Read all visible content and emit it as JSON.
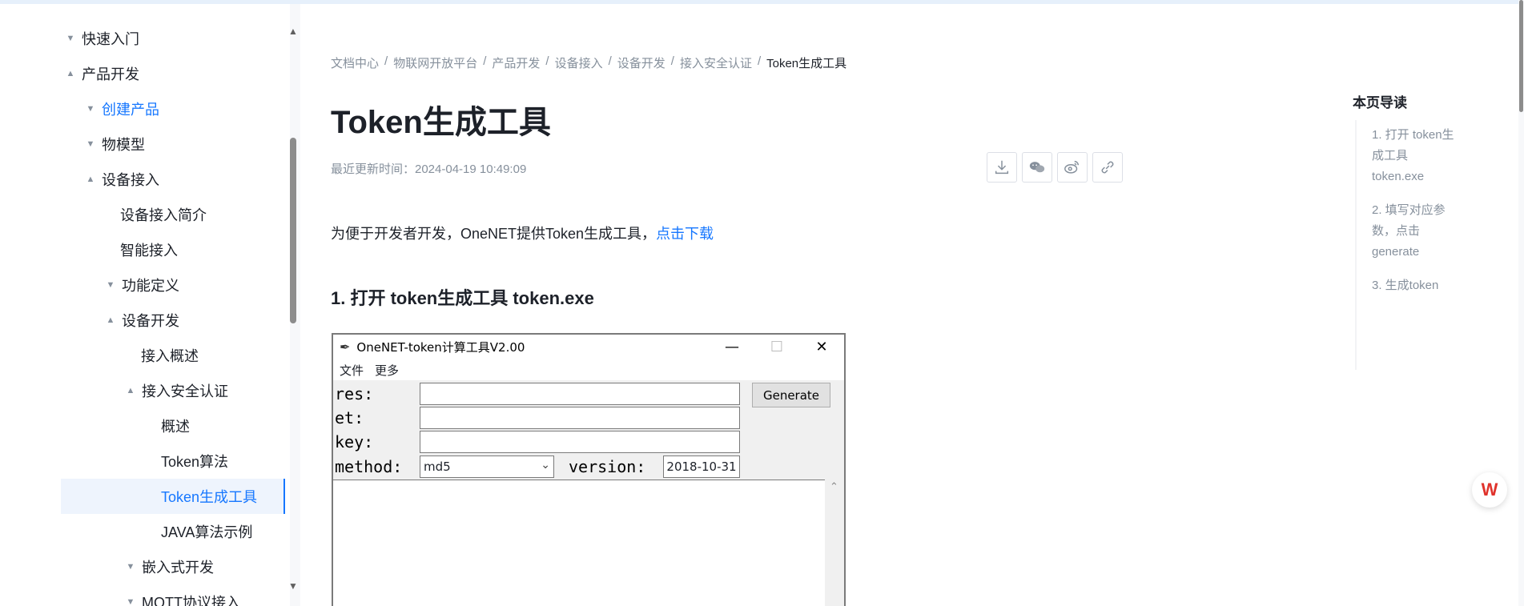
{
  "sidebar": {
    "items": [
      {
        "label": "快速入门",
        "caret": "▼"
      },
      {
        "label": "产品开发",
        "caret": "▲"
      },
      {
        "label": "创建产品",
        "caret": "▼"
      },
      {
        "label": "物模型",
        "caret": "▼"
      },
      {
        "label": "设备接入",
        "caret": "▲"
      },
      {
        "label": "设备接入简介",
        "caret": ""
      },
      {
        "label": "智能接入",
        "caret": ""
      },
      {
        "label": "功能定义",
        "caret": "▼"
      },
      {
        "label": "设备开发",
        "caret": "▲"
      },
      {
        "label": "接入概述",
        "caret": ""
      },
      {
        "label": "接入安全认证",
        "caret": "▲"
      },
      {
        "label": "概述",
        "caret": ""
      },
      {
        "label": "Token算法",
        "caret": ""
      },
      {
        "label": "Token生成工具",
        "caret": ""
      },
      {
        "label": "JAVA算法示例",
        "caret": ""
      },
      {
        "label": "嵌入式开发",
        "caret": "▼"
      },
      {
        "label": "MQTT协议接入",
        "caret": "▼"
      }
    ]
  },
  "breadcrumb": [
    "文档中心",
    "物联网开放平台",
    "产品开发",
    "设备接入",
    "设备开发",
    "接入安全认证",
    "Token生成工具"
  ],
  "page": {
    "title": "Token生成工具",
    "updated": "最近更新时间：2024-04-19 10:49:09",
    "intro_text": "为便于开发者开发，OneNET提供Token生成工具，",
    "intro_link": "点击下载",
    "section1": "1. 打开 token生成工具 token.exe"
  },
  "share": {
    "icons": [
      "download-icon",
      "wechat-icon",
      "weibo-icon",
      "link-icon"
    ]
  },
  "tool_window": {
    "title": "OneNET-token计算工具V2.00",
    "menu": [
      "文件",
      "更多"
    ],
    "labels": {
      "res": "res:",
      "et": "et:",
      "key": "key:",
      "method": "method:",
      "version": "version:"
    },
    "generate": "Generate",
    "method_value": "md5",
    "version_value": "2018-10-31",
    "minimize": "—",
    "maximize": "☐",
    "close": "✕"
  },
  "toc": {
    "title": "本页导读",
    "items": [
      "1. 打开 token生成工具 token.exe",
      "2. 填写对应参数，点击generate",
      "3. 生成token"
    ]
  },
  "colors": {
    "accent": "#1677ff",
    "muted": "#86909c",
    "text": "#1d2129",
    "selected_bg": "#eef4fd"
  }
}
